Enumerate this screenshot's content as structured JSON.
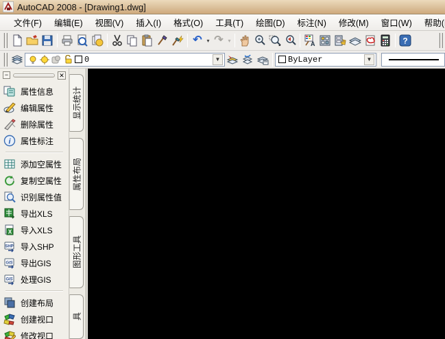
{
  "window": {
    "title": "AutoCAD 2008 - [Drawing1.dwg]"
  },
  "menu": {
    "items": [
      "文件(F)",
      "编辑(E)",
      "视图(V)",
      "插入(I)",
      "格式(O)",
      "工具(T)",
      "绘图(D)",
      "标注(N)",
      "修改(M)",
      "窗口(W)",
      "帮助(H)"
    ]
  },
  "standard_toolbar": {
    "icons": [
      "new",
      "open",
      "save",
      "plot",
      "plot-preview",
      "publish",
      "cut",
      "copy",
      "paste",
      "match-properties",
      "block-editor",
      "undo",
      "undo-list",
      "redo",
      "redo-list",
      "pan",
      "zoom-realtime",
      "zoom-window",
      "zoom-previous",
      "properties",
      "designcenter",
      "tool-palettes",
      "sheet-set-manager",
      "markup-set-manager",
      "quickcalc",
      "help"
    ]
  },
  "layers_toolbar": {
    "icons": [
      "layer-properties-manager",
      "layer-on",
      "layer-freeze",
      "layer-viewport-freeze",
      "layer-lock",
      "make-object-layer-current",
      "layer-previous",
      "layer-states"
    ],
    "layer": {
      "name": "0"
    },
    "color": {
      "value": "ByLayer"
    }
  },
  "palette": {
    "groups": [
      {
        "items": [
          {
            "label": "属性信息",
            "icon": "attribute-info"
          },
          {
            "label": "编辑属性",
            "icon": "edit-attribute"
          },
          {
            "label": "删除属性",
            "icon": "delete-attribute"
          },
          {
            "label": "属性标注",
            "icon": "attribute-annotate"
          }
        ]
      },
      {
        "items": [
          {
            "label": "添加空属性",
            "icon": "add-empty-attribute"
          },
          {
            "label": "复制空属性",
            "icon": "copy-empty-attribute"
          },
          {
            "label": "识别属性值",
            "icon": "recognize-attribute-value"
          },
          {
            "label": "导出XLS",
            "icon": "export-xls"
          },
          {
            "label": "导入XLS",
            "icon": "import-xls"
          },
          {
            "label": "导入SHP",
            "icon": "import-shp"
          },
          {
            "label": "导出GIS",
            "icon": "export-gis"
          },
          {
            "label": "处理GIS",
            "icon": "process-gis"
          }
        ]
      },
      {
        "items": [
          {
            "label": "创建布局",
            "icon": "create-layout"
          },
          {
            "label": "创建视口",
            "icon": "create-viewport"
          },
          {
            "label": "修改视口",
            "icon": "modify-viewport"
          }
        ]
      }
    ],
    "tabs": [
      "显示统计",
      "属性布局",
      "图形工具",
      "具"
    ]
  },
  "colors": {
    "titlebar": "#d9bd97",
    "canvas": "#000000",
    "help_blue": "#3a6db3",
    "excel_green": "#2e8b3a"
  }
}
